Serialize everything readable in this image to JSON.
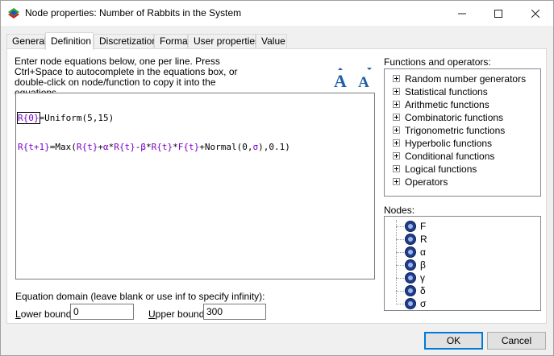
{
  "window": {
    "title": "Node properties: Number of Rabbits in the System",
    "icon": "app-logo-icon"
  },
  "titlebar_buttons": [
    "minimize-icon",
    "maximize-icon",
    "close-icon"
  ],
  "tabs": [
    {
      "label": "General",
      "active": false
    },
    {
      "label": "Definition",
      "active": true
    },
    {
      "label": "Discretization",
      "active": false
    },
    {
      "label": "Format",
      "active": false
    },
    {
      "label": "User properties",
      "active": false
    },
    {
      "label": "Value",
      "active": false
    }
  ],
  "definition": {
    "instructions": "Enter node equations below, one per line. Press Ctrl+Space to autocomplete in the equations box, or double-click on node/function to copy it into the equations.",
    "equations": [
      "R{0}=Uniform(5,15)",
      "R{t+1}=Max(R{t}+α*R{t}-β*R{t}*F{t}+Normal(0,σ),0.1)"
    ],
    "domain_label": "Equation domain (leave blank or use inf to specify infinity):",
    "lower_bound_label": "Lower bound:",
    "lower_bound_value": "0",
    "upper_bound_label": "Upper bound:",
    "upper_bound_value": "300",
    "functions_label": "Functions and operators:",
    "functions": [
      "Random number generators",
      "Statistical functions",
      "Arithmetic functions",
      "Combinatoric functions",
      "Trigonometric functions",
      "Hyperbolic functions",
      "Conditional functions",
      "Logical functions",
      "Operators"
    ],
    "nodes_label": "Nodes:",
    "nodes": [
      "F",
      "R",
      "α",
      "β",
      "γ",
      "δ",
      "σ"
    ]
  },
  "buttons": {
    "ok": "OK",
    "cancel": "Cancel"
  },
  "colors": {
    "accent": "#0078d7",
    "equation_variable": "#7a00c8",
    "node_icon": "#1f3d8a"
  }
}
